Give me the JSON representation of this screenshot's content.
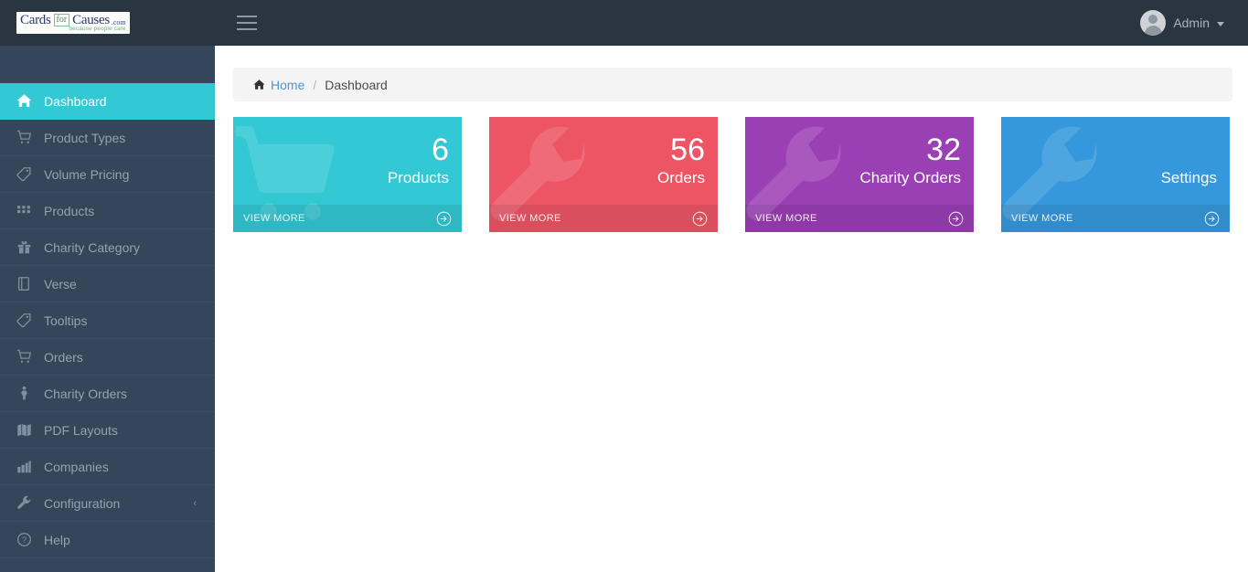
{
  "header": {
    "logo": {
      "cards": "Cards",
      "for": "for",
      "causes": "Causes",
      "com": ".com",
      "tagline": "because people care"
    },
    "menu_toggle_name": "hamburger-menu",
    "user": {
      "name": "Admin"
    }
  },
  "sidebar": {
    "items": [
      {
        "label": "Dashboard",
        "icon": "home-icon",
        "active": true,
        "has_arrow": false
      },
      {
        "label": "Product Types",
        "icon": "shopping-cart-icon",
        "active": false,
        "has_arrow": false
      },
      {
        "label": "Volume Pricing",
        "icon": "tag-icon",
        "active": false,
        "has_arrow": false
      },
      {
        "label": "Products",
        "icon": "grid-icon",
        "active": false,
        "has_arrow": false
      },
      {
        "label": "Charity Category",
        "icon": "gift-icon",
        "active": false,
        "has_arrow": false
      },
      {
        "label": "Verse",
        "icon": "book-icon",
        "active": false,
        "has_arrow": false
      },
      {
        "label": "Tooltips",
        "icon": "tag-icon",
        "active": false,
        "has_arrow": false
      },
      {
        "label": "Orders",
        "icon": "shopping-cart-icon",
        "active": false,
        "has_arrow": false
      },
      {
        "label": "Charity Orders",
        "icon": "person-icon",
        "active": false,
        "has_arrow": false
      },
      {
        "label": "PDF Layouts",
        "icon": "map-icon",
        "active": false,
        "has_arrow": false
      },
      {
        "label": "Companies",
        "icon": "factory-icon",
        "active": false,
        "has_arrow": false
      },
      {
        "label": "Configuration",
        "icon": "wrench-icon",
        "active": false,
        "has_arrow": true,
        "arrow": "‹"
      },
      {
        "label": "Help",
        "icon": "question-circle-icon",
        "active": false,
        "has_arrow": false
      }
    ]
  },
  "breadcrumb": {
    "home_label": "Home",
    "separator": "/",
    "current": "Dashboard"
  },
  "cards": [
    {
      "number": "6",
      "title": "Products",
      "footer_label": "VIEW MORE",
      "color": "#32c8d4",
      "watermark": "shopping-cart-icon"
    },
    {
      "number": "56",
      "title": "Orders",
      "footer_label": "VIEW MORE",
      "color": "#ed5565",
      "watermark": "wrench-icon"
    },
    {
      "number": "32",
      "title": "Charity Orders",
      "footer_label": "VIEW MORE",
      "color": "#9b3fb5",
      "watermark": "wrench-icon"
    },
    {
      "number": "",
      "title": "Settings",
      "footer_label": "VIEW MORE",
      "color": "#3598dc",
      "watermark": "wrench-icon"
    }
  ]
}
